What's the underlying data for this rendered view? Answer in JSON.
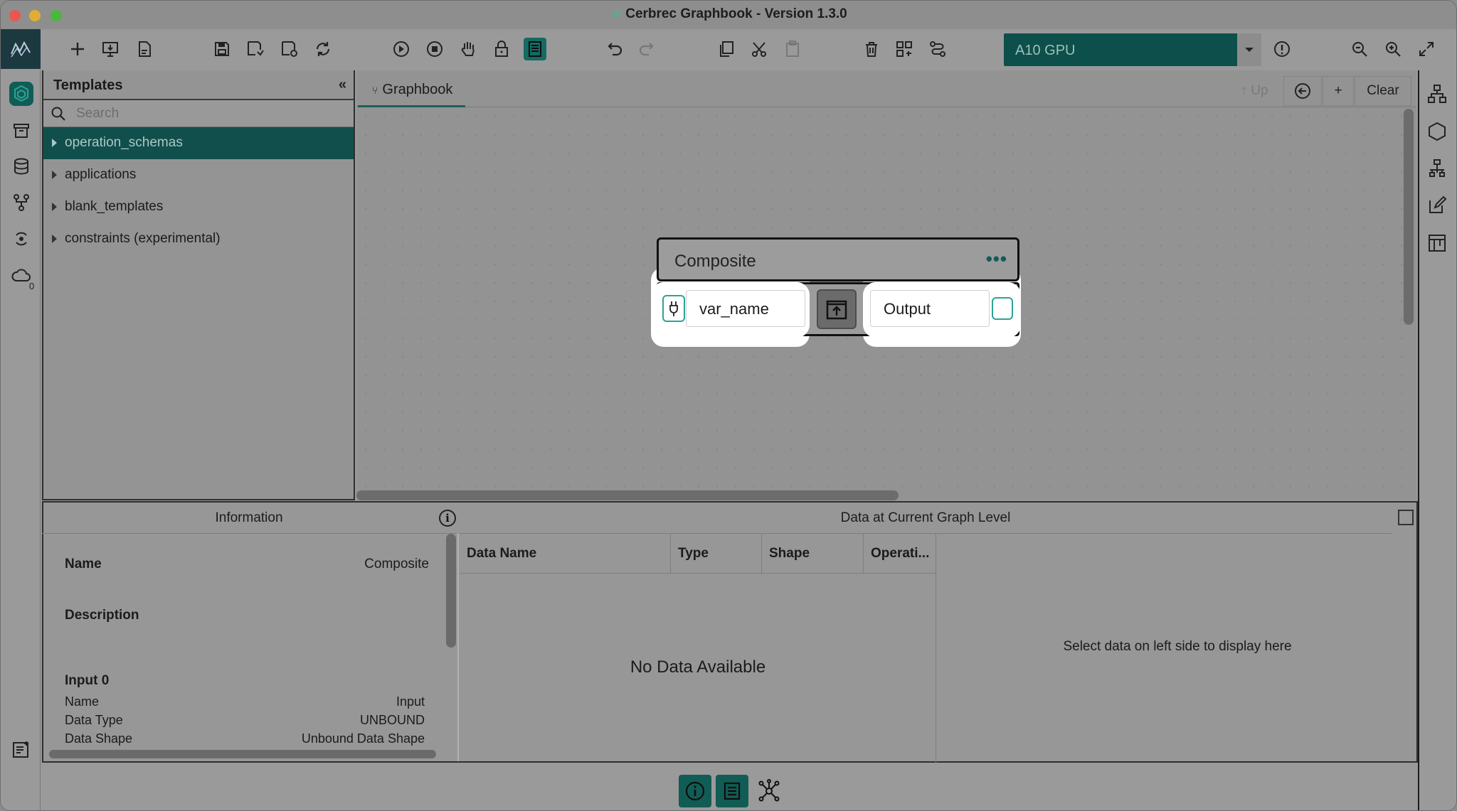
{
  "window": {
    "title": "Cerbrec Graphbook - Version 1.3.0"
  },
  "toolbar": {
    "device_select": "A10 GPU"
  },
  "templates": {
    "header": "Templates",
    "search_placeholder": "Search",
    "items": [
      {
        "label": "operation_schemas",
        "selected": true
      },
      {
        "label": "applications",
        "selected": false
      },
      {
        "label": "blank_templates",
        "selected": false
      },
      {
        "label": "constraints (experimental)",
        "selected": false
      }
    ]
  },
  "canvas": {
    "tab_label": "Graphbook",
    "up_label": "↑ Up",
    "plus_label": "+",
    "clear_label": "Clear",
    "node": {
      "title": "Composite",
      "input_value": "var_name",
      "output_value": "Output"
    }
  },
  "information": {
    "header": "Information",
    "name_label": "Name",
    "name_value": "Composite",
    "description_label": "Description",
    "input_section": "Input 0",
    "rows": [
      {
        "label": "Name",
        "value": "Input"
      },
      {
        "label": "Data Type",
        "value": "UNBOUND"
      },
      {
        "label": "Data Shape",
        "value": "Unbound Data Shape"
      }
    ]
  },
  "data_panel": {
    "header": "Data at Current Graph Level",
    "columns": [
      "Data Name",
      "Type",
      "Shape",
      "Operati..."
    ],
    "empty_text": "No Data Available",
    "right_hint": "Select data on left side to display here"
  },
  "colors": {
    "accent": "#125c56",
    "port": "#2ea394",
    "highlight": "#ffffff"
  },
  "left_rail_badge": "0"
}
